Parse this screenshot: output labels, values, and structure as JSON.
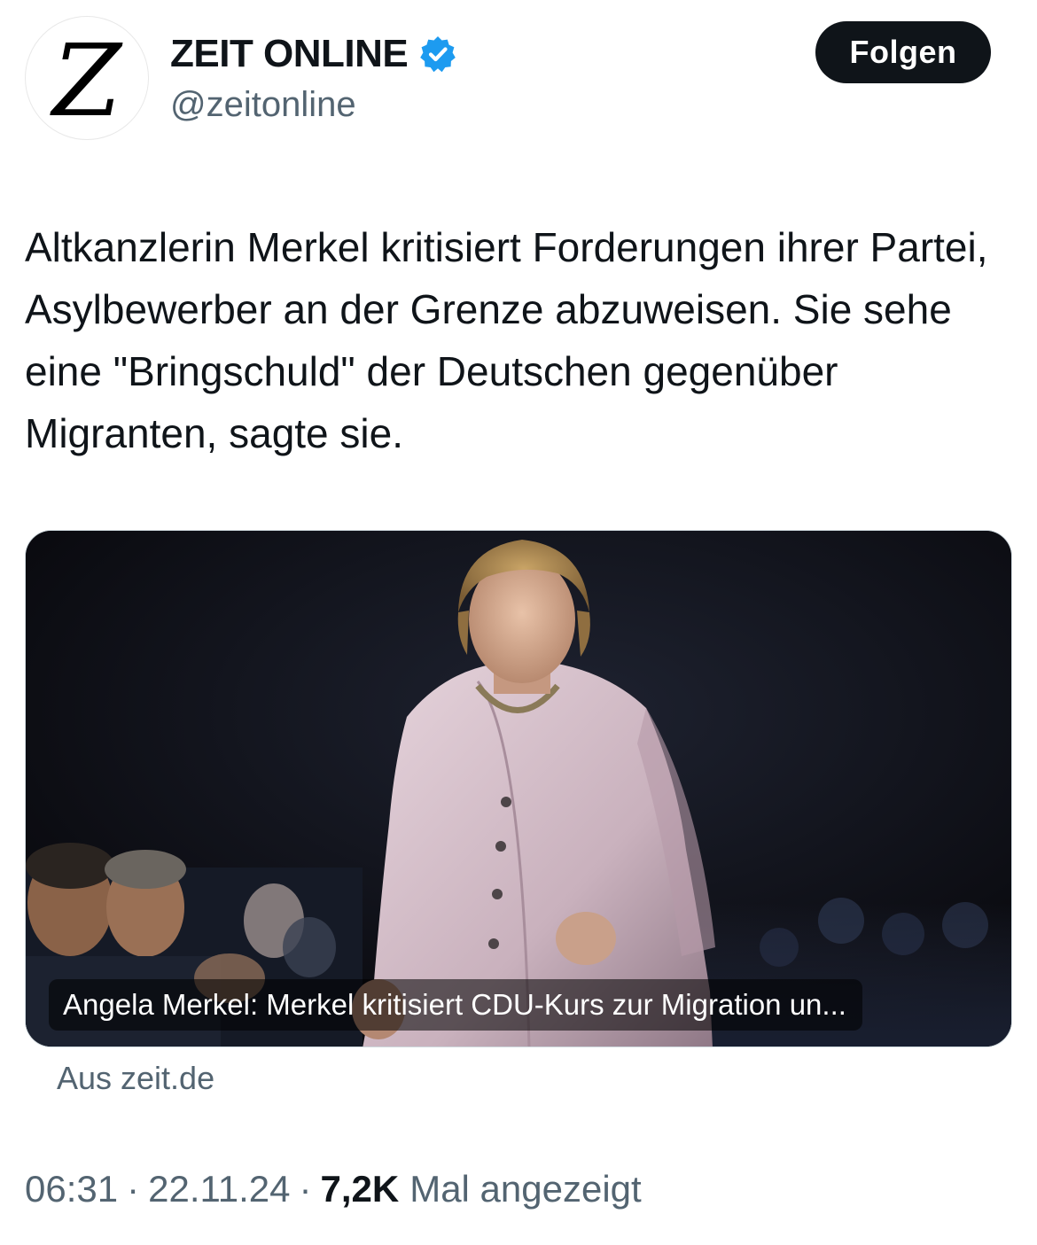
{
  "account": {
    "display_name": "ZEIT ONLINE",
    "handle": "@zeitonline",
    "avatar_letter": "Z",
    "verified_color": "#1d9bf0"
  },
  "follow_label": "Folgen",
  "tweet": {
    "text": "Altkanzlerin Merkel kritisiert Forderungen ihrer Partei, Asylbewerber an der Grenze abzuweisen. Sie sehe eine \"Bringschuld\" der Deutschen gegenüber Migranten, sagte sie."
  },
  "card": {
    "caption": "Angela Merkel: Merkel kritisiert CDU-Kurs zur Migration un...",
    "source": "Aus zeit.de",
    "image_description_icon": "photo-icon"
  },
  "meta": {
    "time": "06:31",
    "date": "22.11.24",
    "separator": "·",
    "views_count": "7,2K",
    "views_label": "Mal angezeigt"
  },
  "colors": {
    "text_primary": "#0f1419",
    "text_secondary": "#536471",
    "button_bg": "#0f1419",
    "verified": "#1d9bf0"
  }
}
